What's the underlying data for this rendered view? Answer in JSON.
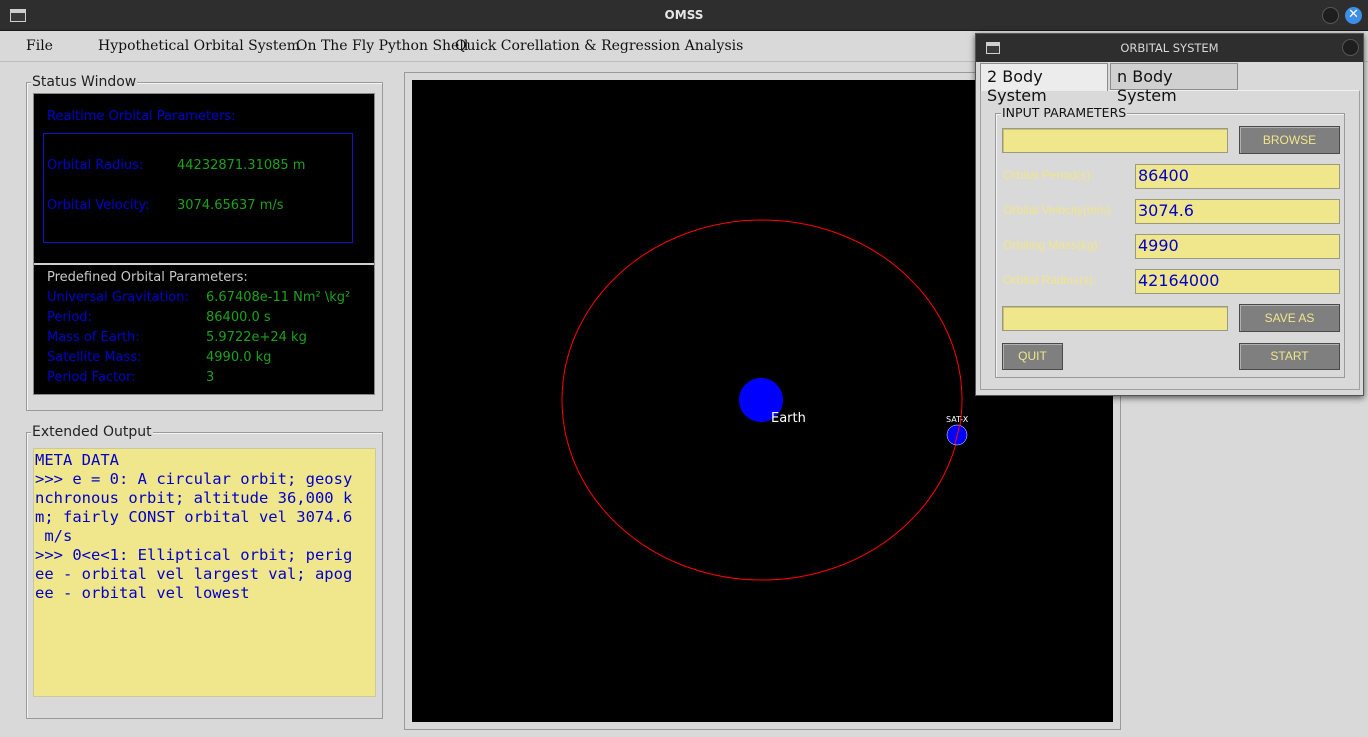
{
  "window": {
    "title": "OMSS"
  },
  "menubar": {
    "items": [
      "File",
      "Hypothetical Orbital System",
      "On The Fly Python Shell",
      "Quick Corellation & Regression Analysis"
    ]
  },
  "status_window": {
    "label": "Status Window",
    "realtime_title": "Realtime Orbital Parameters:",
    "realtime": [
      {
        "label": "Orbital Radius:",
        "value": "44232871.31085 m"
      },
      {
        "label": "Orbital Velocity:",
        "value": "3074.65637 m/s"
      }
    ],
    "predefined_title": "Predefined Orbital Parameters:",
    "predefined": [
      {
        "label": "Universal Gravitation:",
        "value": "6.67408e-11 Nm² \\kg²"
      },
      {
        "label": "Period:",
        "value": "86400.0 s"
      },
      {
        "label": "Mass of Earth:",
        "value": "5.9722e+24 kg"
      },
      {
        "label": "Satellite Mass:",
        "value": "4990.0 kg"
      },
      {
        "label": "Period Factor:",
        "value": "3"
      }
    ]
  },
  "extended_output": {
    "label": "Extended Output",
    "lines": [
      "META DATA",
      "",
      ">>> e = 0: A circular orbit; geosy",
      "nchronous orbit; altitude 36,000 k",
      "m; fairly CONST orbital vel 3074.6",
      " m/s",
      ">>> 0<e<1: Elliptical orbit; perig",
      "ee - orbital vel largest val; apog",
      "ee - orbital vel lowest"
    ]
  },
  "canvas": {
    "earth_label": "Earth",
    "satellite_label": "SAT-X",
    "colors": {
      "orbit": "#ff0000",
      "body": "#0000ff",
      "background": "#000000"
    }
  },
  "dialog": {
    "title": "ORBITAL SYSTEM",
    "tabs": [
      "2 Body System",
      "n Body System"
    ],
    "active_tab": "2 Body System",
    "group_label": "INPUT PARAMETERS",
    "browse_button": "BROWSE",
    "save_as_button": "SAVE AS",
    "quit_button": "QUIT",
    "start_button": "START",
    "fields": [
      {
        "label": "Orbital Period(s):",
        "value": "86400"
      },
      {
        "label": "Orbital Velocity(m/s):",
        "value": "3074.6"
      },
      {
        "label": "Orbiting Mass(kg):",
        "value": "4990"
      },
      {
        "label": "Orbital Radius(s):",
        "value": "42164000"
      }
    ],
    "file_path_value": "",
    "save_path_value": ""
  }
}
